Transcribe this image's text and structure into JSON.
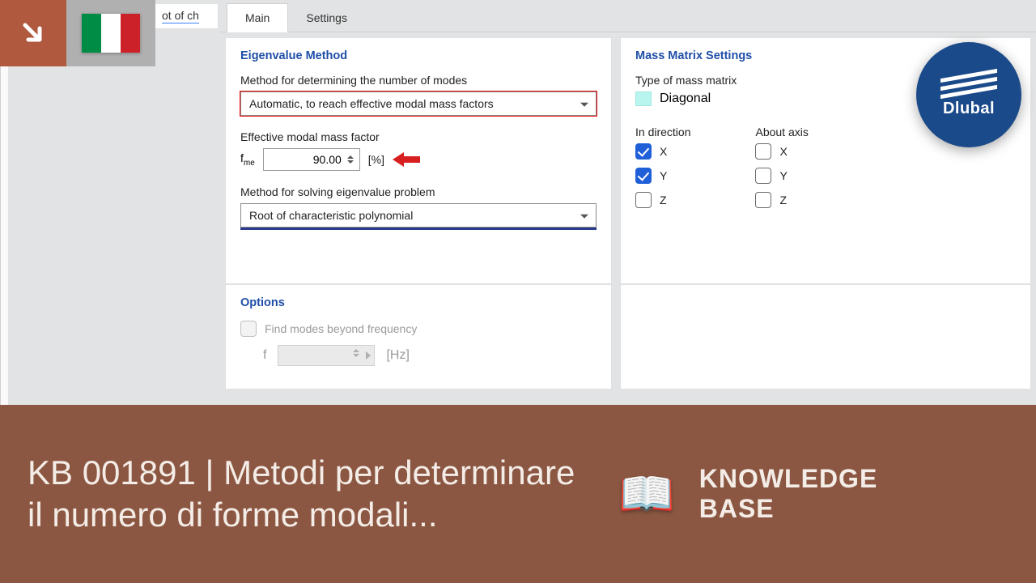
{
  "sidebar": {
    "fragment_text": "ot of ch"
  },
  "tabs": {
    "main": "Main",
    "settings": "Settings"
  },
  "eigen": {
    "title": "Eigenvalue Method",
    "method_modes_label": "Method for determining the number of modes",
    "method_modes_value": "Automatic, to reach effective modal mass factors",
    "emmf_label": "Effective modal mass factor",
    "fme_symbol": "f",
    "fme_sub": "me",
    "fme_value": "90.00",
    "fme_unit": "[%]",
    "method_solve_label": "Method for solving eigenvalue problem",
    "method_solve_value": "Root of characteristic polynomial"
  },
  "mass": {
    "title": "Mass Matrix Settings",
    "type_label": "Type of mass matrix",
    "type_value": "Diagonal",
    "in_direction_label": "In direction",
    "about_axis_label": "About axis",
    "dir_x": "X",
    "dir_y": "Y",
    "dir_z": "Z",
    "axis_x": "X",
    "axis_y": "Y",
    "axis_z": "Z",
    "checked": {
      "dir_x": true,
      "dir_y": true,
      "dir_z": false,
      "axis_x": false,
      "axis_y": false,
      "axis_z": false
    }
  },
  "options": {
    "title": "Options",
    "find_modes": "Find modes beyond frequency",
    "f_symbol": "f",
    "f_unit": "[Hz]"
  },
  "dlubal": "Dlubal",
  "banner": {
    "title": "KB 001891 | Metodi per determinare il numero di forme modali...",
    "kb_line1": "KNOWLEDGE",
    "kb_line2": "BASE"
  }
}
